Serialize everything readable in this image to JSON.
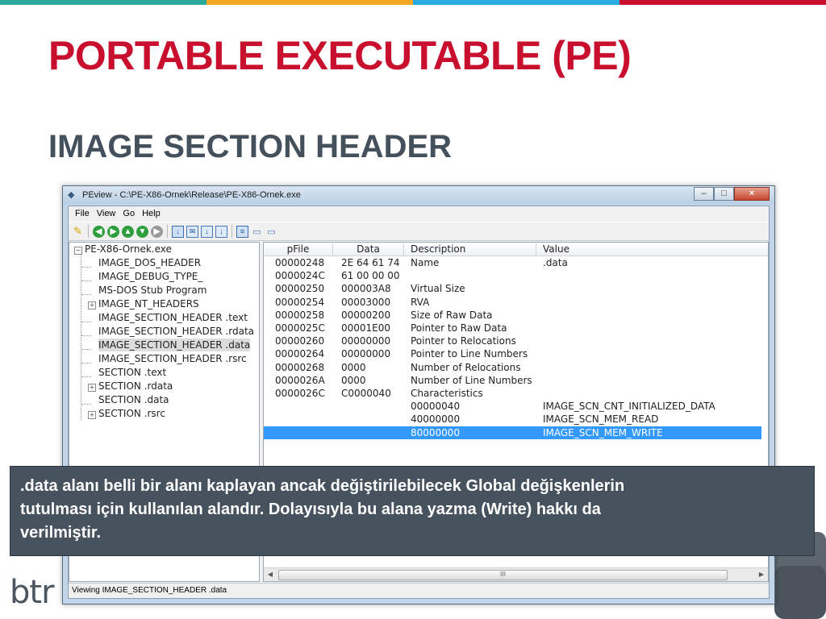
{
  "slide": {
    "title": "PORTABLE EXECUTABLE (PE)",
    "subtitle": "IMAGE SECTION HEADER",
    "accent_colors": [
      "#2aa89a",
      "#f5a623",
      "#29abe2",
      "#c8102e"
    ],
    "title_color": "#c8102e",
    "subtitle_color": "#44505c",
    "logo_text": "btr"
  },
  "window": {
    "title": "PEview - C:\\PE-X86-Ornek\\Release\\PE-X86-Ornek.exe",
    "buttons": [
      "minimize-button",
      "maximize-button",
      "close-button"
    ],
    "menu": [
      "File",
      "View",
      "Go",
      "Help"
    ],
    "toolbar_icons": [
      "open-icon",
      "back-icon",
      "forward-icon",
      "up-icon",
      "down-icon",
      "stop-icon",
      "view-byte-icon",
      "view-word-icon",
      "view-dword-icon",
      "view-qword-icon",
      "view-list-icon",
      "view-small-icon",
      "view-large-icon"
    ],
    "tree": [
      {
        "label": "PE-X86-Ornek.exe",
        "expander": "-"
      },
      {
        "label": "IMAGE_DOS_HEADER"
      },
      {
        "label": "IMAGE_DEBUG_TYPE_"
      },
      {
        "label": "MS-DOS Stub Program"
      },
      {
        "label": "IMAGE_NT_HEADERS",
        "expander": "+"
      },
      {
        "label": "IMAGE_SECTION_HEADER .text"
      },
      {
        "label": "IMAGE_SECTION_HEADER .rdata"
      },
      {
        "label": "IMAGE_SECTION_HEADER .data",
        "selected": true
      },
      {
        "label": "IMAGE_SECTION_HEADER .rsrc"
      },
      {
        "label": "SECTION .text"
      },
      {
        "label": "SECTION .rdata",
        "expander": "+"
      },
      {
        "label": "SECTION .data"
      },
      {
        "label": "SECTION .rsrc",
        "expander": "+"
      }
    ],
    "list_columns": [
      "pFile",
      "Data",
      "Description",
      "Value"
    ],
    "list_rows": [
      {
        "pfile": "00000248",
        "data": "2E  64  61  74",
        "desc": "Name",
        "value": ".data"
      },
      {
        "pfile": "0000024C",
        "data": "61  00  00  00",
        "desc": "",
        "value": ""
      },
      {
        "pfile": "00000250",
        "data": "000003A8",
        "desc": "Virtual Size",
        "value": ""
      },
      {
        "pfile": "00000254",
        "data": "00003000",
        "desc": "RVA",
        "value": ""
      },
      {
        "pfile": "00000258",
        "data": "00000200",
        "desc": "Size of Raw Data",
        "value": ""
      },
      {
        "pfile": "0000025C",
        "data": "00001E00",
        "desc": "Pointer to Raw Data",
        "value": ""
      },
      {
        "pfile": "00000260",
        "data": "00000000",
        "desc": "Pointer to Relocations",
        "value": ""
      },
      {
        "pfile": "00000264",
        "data": "00000000",
        "desc": "Pointer to Line Numbers",
        "value": ""
      },
      {
        "pfile": "00000268",
        "data": "0000",
        "desc": "Number of Relocations",
        "value": ""
      },
      {
        "pfile": "0000026A",
        "data": "0000",
        "desc": "Number of Line Numbers",
        "value": ""
      },
      {
        "pfile": "0000026C",
        "data": "C0000040",
        "desc": "Characteristics",
        "value": ""
      },
      {
        "pfile": "",
        "data": "",
        "desc": "00000040",
        "value": "IMAGE_SCN_CNT_INITIALIZED_DATA"
      },
      {
        "pfile": "",
        "data": "",
        "desc": "40000000",
        "value": "IMAGE_SCN_MEM_READ"
      },
      {
        "pfile": "",
        "data": "",
        "desc": "80000000",
        "value": "IMAGE_SCN_MEM_WRITE",
        "selected": true
      }
    ],
    "scroll_thumb_grip": "III",
    "status_text": "Viewing IMAGE_SECTION_HEADER .data",
    "selection_color": "#3399ff"
  },
  "callout": {
    "lines": [
      ".data alanı belli bir alanı kaplayan ancak değiştirilebilecek Global değişkenlerin",
      "tutulması için kullanılan alandır. Dolayısıyla bu alana yazma (Write) hakkı da",
      "verilmiştir."
    ],
    "background": "#46535f"
  }
}
